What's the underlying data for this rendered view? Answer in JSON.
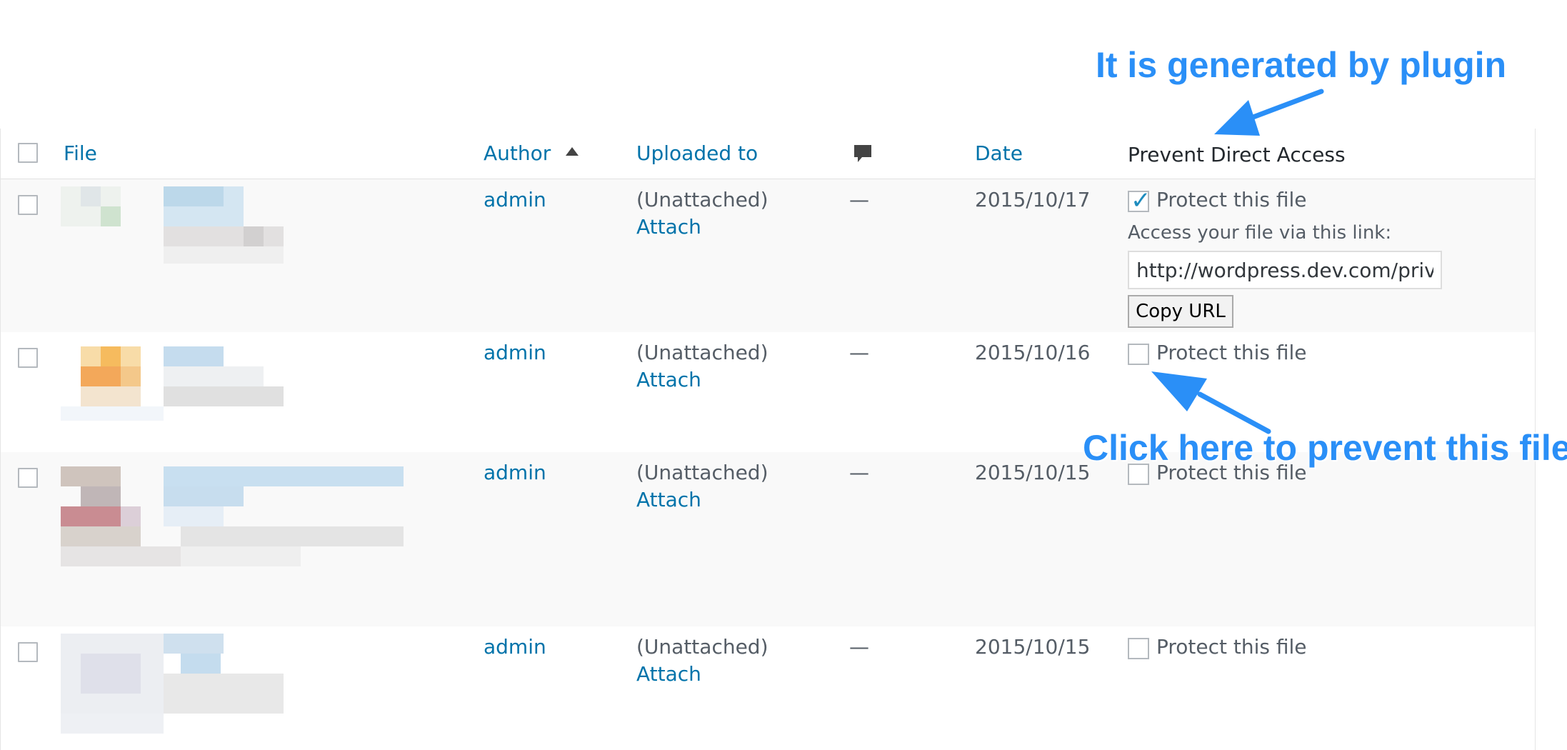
{
  "header": {
    "file": "File",
    "author": "Author",
    "author_sort_icon": "sort-up-icon",
    "uploaded_to": "Uploaded to",
    "comments_icon": "comment-bubble-icon",
    "date": "Date",
    "pda": "Prevent Direct Access"
  },
  "rows": [
    {
      "author": "admin",
      "uploaded": "(Unattached)",
      "attach": "Attach",
      "comments": "—",
      "date": "2015/10/17",
      "protected": true,
      "protect_label": "Protect this file",
      "access_label": "Access your file via this link:",
      "url": "http://wordpress.dev.com/private/",
      "copy": "Copy URL"
    },
    {
      "author": "admin",
      "uploaded": "(Unattached)",
      "attach": "Attach",
      "comments": "—",
      "date": "2015/10/16",
      "protected": false,
      "protect_label": "Protect this file"
    },
    {
      "author": "admin",
      "uploaded": "(Unattached)",
      "attach": "Attach",
      "comments": "—",
      "date": "2015/10/15",
      "protected": false,
      "protect_label": "Protect this file"
    },
    {
      "author": "admin",
      "uploaded": "(Unattached)",
      "attach": "Attach",
      "comments": "—",
      "date": "2015/10/15",
      "protected": false,
      "protect_label": "Protect this file"
    }
  ],
  "annotations": {
    "top": "It is generated by plugin",
    "bottom": "Click here to prevent this file"
  },
  "colors": {
    "link": "#0073aa",
    "annotation": "#2a8ff7",
    "checkmark": "#1e8cbe"
  }
}
